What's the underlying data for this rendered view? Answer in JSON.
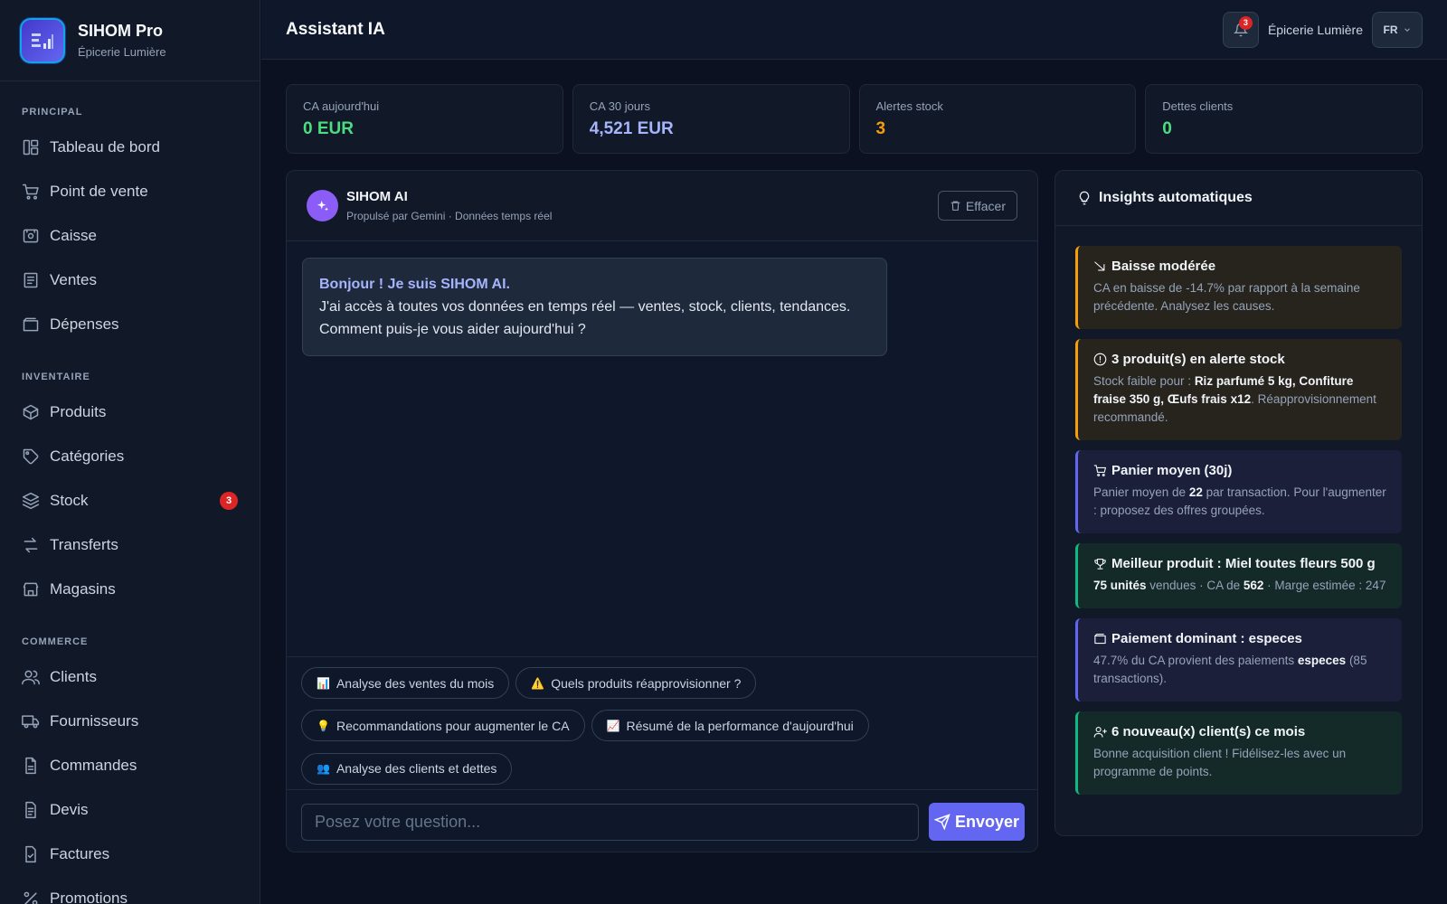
{
  "brand": {
    "name": "SIHOM Pro",
    "subtitle": "Épicerie Lumière"
  },
  "nav": [
    {
      "heading": "PRINCIPAL",
      "items": [
        {
          "label": "Tableau de bord",
          "icon": "dashboard-icon"
        },
        {
          "label": "Point de vente",
          "icon": "cart-icon"
        },
        {
          "label": "Caisse",
          "icon": "cash-register-icon"
        },
        {
          "label": "Ventes",
          "icon": "receipt-icon"
        },
        {
          "label": "Dépenses",
          "icon": "wallet-icon"
        }
      ]
    },
    {
      "heading": "INVENTAIRE",
      "items": [
        {
          "label": "Produits",
          "icon": "box-icon"
        },
        {
          "label": "Catégories",
          "icon": "tag-icon"
        },
        {
          "label": "Stock",
          "icon": "layers-icon",
          "badge": "3"
        },
        {
          "label": "Transferts",
          "icon": "transfer-icon"
        },
        {
          "label": "Magasins",
          "icon": "store-icon"
        }
      ]
    },
    {
      "heading": "COMMERCE",
      "items": [
        {
          "label": "Clients",
          "icon": "users-icon"
        },
        {
          "label": "Fournisseurs",
          "icon": "truck-icon"
        },
        {
          "label": "Commandes",
          "icon": "document-icon"
        },
        {
          "label": "Devis",
          "icon": "quote-icon"
        },
        {
          "label": "Factures",
          "icon": "invoice-icon"
        },
        {
          "label": "Promotions",
          "icon": "percent-icon"
        }
      ]
    }
  ],
  "header": {
    "title": "Assistant IA",
    "notification_count": "3",
    "store": "Épicerie Lumière",
    "language": "FR"
  },
  "kpis": [
    {
      "label": "CA aujourd'hui",
      "value": "0 EUR",
      "color": "#4ade80"
    },
    {
      "label": "CA 30 jours",
      "value": "4,521 EUR",
      "color": "#a5b4fc"
    },
    {
      "label": "Alertes stock",
      "value": "3",
      "color": "#f59e0b"
    },
    {
      "label": "Dettes clients",
      "value": "0",
      "color": "#4ade80"
    }
  ],
  "chat": {
    "bot_name": "SIHOM AI",
    "bot_subtitle": "Propulsé par Gemini · Données temps réel",
    "clear_label": "Effacer",
    "welcome_hello": "Bonjour ! Je suis SIHOM AI.",
    "welcome_line1": "J'ai accès à toutes vos données en temps réel — ventes, stock, clients, tendances.",
    "welcome_line2": "Comment puis-je vous aider aujourd'hui ?",
    "suggestions": [
      {
        "emoji": "📊",
        "label": "Analyse des ventes du mois"
      },
      {
        "emoji": "⚠️",
        "label": "Quels produits réapprovisionner ?"
      },
      {
        "emoji": "💡",
        "label": "Recommandations pour augmenter le CA"
      },
      {
        "emoji": "📈",
        "label": "Résumé de la performance d'aujourd'hui"
      },
      {
        "emoji": "👥",
        "label": "Analyse des clients et dettes"
      }
    ],
    "input_placeholder": "Posez votre question...",
    "input_value": "",
    "send_label": "Envoyer"
  },
  "insights": {
    "title": "Insights automatiques",
    "cards": [
      {
        "variant": "warn",
        "icon": "trend-down-icon",
        "title": "Baisse modérée",
        "parts": [
          {
            "t": "CA en baisse de -14.7% par rapport à la semaine précédente. Analysez les causes."
          }
        ]
      },
      {
        "variant": "warn",
        "icon": "alert-circle-icon",
        "title": "3 produit(s) en alerte stock",
        "parts": [
          {
            "t": "Stock faible pour : "
          },
          {
            "t": "Riz parfumé 5 kg, Confiture fraise 350 g, Œufs frais x12",
            "b": true
          },
          {
            "t": ". Réapprovisionnement recommandé."
          }
        ]
      },
      {
        "variant": "info",
        "icon": "cart-icon",
        "title": "Panier moyen (30j)",
        "parts": [
          {
            "t": "Panier moyen de "
          },
          {
            "t": "22",
            "b": true
          },
          {
            "t": " par transaction. Pour l'augmenter : proposez des offres groupées."
          }
        ]
      },
      {
        "variant": "good",
        "icon": "trophy-icon",
        "title": "Meilleur produit : Miel toutes fleurs 500 g",
        "parts": [
          {
            "t": "75 unités",
            "b": true
          },
          {
            "t": " vendues · CA de "
          },
          {
            "t": "562",
            "b": true
          },
          {
            "t": " · Marge estimée : 247"
          }
        ]
      },
      {
        "variant": "info",
        "icon": "wallet-icon",
        "title": "Paiement dominant : especes",
        "parts": [
          {
            "t": "47.7% du CA provient des paiements "
          },
          {
            "t": "especes",
            "b": true
          },
          {
            "t": " (85 transactions)."
          }
        ]
      },
      {
        "variant": "good",
        "icon": "user-plus-icon",
        "title": "6 nouveau(x) client(s) ce mois",
        "parts": [
          {
            "t": "Bonne acquisition client ! Fidélisez-les avec un programme de points."
          }
        ]
      }
    ]
  }
}
